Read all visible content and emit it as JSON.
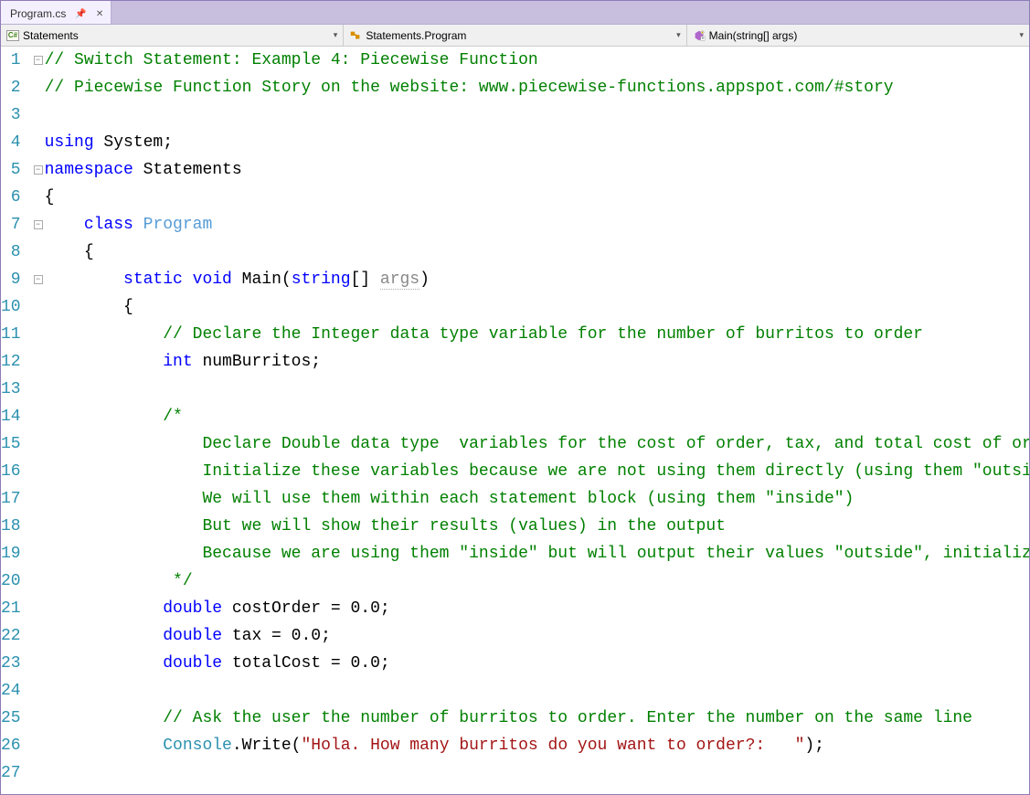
{
  "tab": {
    "filename": "Program.cs"
  },
  "nav": {
    "scope": "Statements",
    "class": "Statements.Program",
    "method": "Main(string[] args)"
  },
  "glyphs": {
    "cs_badge": "C#",
    "dropdown": "▾",
    "fold_minus": "−"
  },
  "code": {
    "lines": [
      {
        "n": 1,
        "fold": "minus",
        "mod": false,
        "tokens": [
          [
            "comment",
            "// Switch Statement: Example 4: Piecewise Function"
          ]
        ]
      },
      {
        "n": 2,
        "fold": "",
        "mod": false,
        "tokens": [
          [
            "comment",
            "// Piecewise Function Story on the website: www.piecewise-functions.appspot.com/#story"
          ]
        ]
      },
      {
        "n": 3,
        "fold": "",
        "mod": false,
        "tokens": [
          [
            "",
            ""
          ]
        ]
      },
      {
        "n": 4,
        "fold": "",
        "mod": false,
        "tokens": [
          [
            "keyword",
            "using"
          ],
          [
            "",
            " System;"
          ]
        ]
      },
      {
        "n": 5,
        "fold": "minus",
        "mod": false,
        "tokens": [
          [
            "keyword",
            "namespace"
          ],
          [
            "",
            " Statements"
          ]
        ]
      },
      {
        "n": 6,
        "fold": "",
        "mod": false,
        "tokens": [
          [
            "",
            "{"
          ]
        ]
      },
      {
        "n": 7,
        "fold": "minus",
        "mod": false,
        "tokens": [
          [
            "",
            "    "
          ],
          [
            "keyword",
            "class"
          ],
          [
            "",
            " "
          ],
          [
            "type2",
            "Program"
          ]
        ]
      },
      {
        "n": 8,
        "fold": "",
        "mod": false,
        "tokens": [
          [
            "",
            "    {"
          ]
        ]
      },
      {
        "n": 9,
        "fold": "minus",
        "mod": false,
        "tokens": [
          [
            "",
            "        "
          ],
          [
            "keyword",
            "static"
          ],
          [
            "",
            " "
          ],
          [
            "keyword",
            "void"
          ],
          [
            "",
            " Main("
          ],
          [
            "keyword",
            "string"
          ],
          [
            "",
            "[] "
          ],
          [
            "paramhint",
            "args"
          ],
          [
            "",
            ")"
          ]
        ]
      },
      {
        "n": 10,
        "fold": "",
        "mod": false,
        "tokens": [
          [
            "",
            "        {"
          ]
        ]
      },
      {
        "n": 11,
        "fold": "",
        "mod": true,
        "tokens": [
          [
            "",
            "            "
          ],
          [
            "comment",
            "// Declare the Integer data type variable for the number of burritos to order"
          ]
        ]
      },
      {
        "n": 12,
        "fold": "",
        "mod": true,
        "tokens": [
          [
            "",
            "            "
          ],
          [
            "keyword",
            "int"
          ],
          [
            "",
            " numBurritos;"
          ]
        ]
      },
      {
        "n": 13,
        "fold": "",
        "mod": true,
        "tokens": [
          [
            "",
            ""
          ]
        ]
      },
      {
        "n": 14,
        "fold": "",
        "mod": true,
        "tokens": [
          [
            "",
            "            "
          ],
          [
            "comment",
            "/*"
          ]
        ]
      },
      {
        "n": 15,
        "fold": "",
        "mod": true,
        "tokens": [
          [
            "",
            "                "
          ],
          [
            "comment",
            "Declare Double data type  variables for the cost of order, tax, and total cost of order"
          ]
        ]
      },
      {
        "n": 16,
        "fold": "",
        "mod": true,
        "tokens": [
          [
            "",
            "                "
          ],
          [
            "comment",
            "Initialize these variables because we are not using them directly (using them \"outside\")"
          ]
        ]
      },
      {
        "n": 17,
        "fold": "",
        "mod": true,
        "tokens": [
          [
            "",
            "                "
          ],
          [
            "comment",
            "We will use them within each statement block (using them \"inside\")"
          ]
        ]
      },
      {
        "n": 18,
        "fold": "",
        "mod": true,
        "tokens": [
          [
            "",
            "                "
          ],
          [
            "comment",
            "But we will show their results (values) in the output"
          ]
        ]
      },
      {
        "n": 19,
        "fold": "",
        "mod": true,
        "tokens": [
          [
            "",
            "                "
          ],
          [
            "comment",
            "Because we are using them \"inside\" but will output their values \"outside\", initialize them"
          ]
        ]
      },
      {
        "n": 20,
        "fold": "",
        "mod": true,
        "tokens": [
          [
            "",
            "             "
          ],
          [
            "comment",
            "*/"
          ]
        ]
      },
      {
        "n": 21,
        "fold": "",
        "mod": true,
        "tokens": [
          [
            "",
            "            "
          ],
          [
            "keyword",
            "double"
          ],
          [
            "",
            " costOrder = 0.0;"
          ]
        ]
      },
      {
        "n": 22,
        "fold": "",
        "mod": true,
        "tokens": [
          [
            "",
            "            "
          ],
          [
            "keyword",
            "double"
          ],
          [
            "",
            " tax = 0.0;"
          ]
        ]
      },
      {
        "n": 23,
        "fold": "",
        "mod": true,
        "tokens": [
          [
            "",
            "            "
          ],
          [
            "keyword",
            "double"
          ],
          [
            "",
            " totalCost = 0.0;"
          ]
        ]
      },
      {
        "n": 24,
        "fold": "",
        "mod": true,
        "tokens": [
          [
            "",
            ""
          ]
        ]
      },
      {
        "n": 25,
        "fold": "",
        "mod": true,
        "tokens": [
          [
            "",
            "            "
          ],
          [
            "comment",
            "// Ask the user the number of burritos to order. Enter the number on the same line"
          ]
        ]
      },
      {
        "n": 26,
        "fold": "",
        "mod": true,
        "tokens": [
          [
            "",
            "            "
          ],
          [
            "type",
            "Console"
          ],
          [
            "",
            ".Write("
          ],
          [
            "string",
            "\"Hola. How many burritos do you want to order?:   \""
          ],
          [
            "",
            ");"
          ]
        ]
      },
      {
        "n": 27,
        "fold": "",
        "mod": true,
        "tokens": [
          [
            "",
            ""
          ]
        ]
      }
    ]
  }
}
